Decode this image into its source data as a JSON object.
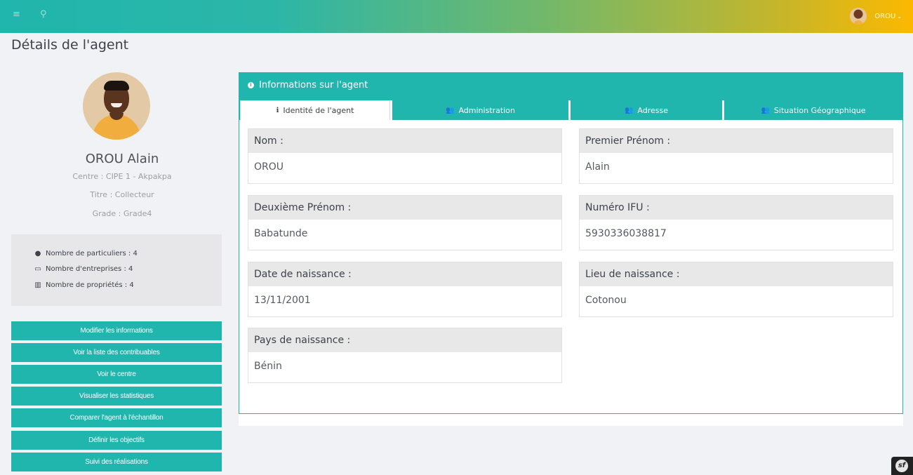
{
  "topbar": {
    "menu_icon": "hamburger-icon",
    "search_icon": "search-icon",
    "user_name": "OROU",
    "caret": "⌄"
  },
  "page": {
    "title": "Détails de l'agent"
  },
  "profile": {
    "name": "OROU Alain",
    "centre": "Centre : CIPE 1 - Akpakpa",
    "titre": "Titre : Collecteur",
    "grade": "Grade : Grade4"
  },
  "stats": [
    {
      "icon": "user-icon",
      "label": "Nombre de particuliers : 4"
    },
    {
      "icon": "desktop-icon",
      "label": "Nombre d'entreprises : 4"
    },
    {
      "icon": "bank-icon",
      "label": "Nombre de propriétés : 4"
    }
  ],
  "actions": [
    "Modifier les informations",
    "Voir la liste des contribuables",
    "Voir le centre",
    "Visualiser les statistiques",
    "Comparer l'agent à l'échantillon",
    "Définir les objectifs",
    "Suivi des réalisations"
  ],
  "panel": {
    "title": "Informations sur l'agent",
    "tabs": [
      {
        "icon": "info-icon",
        "label": "Identité de l'agent",
        "active": true
      },
      {
        "icon": "users-icon",
        "label": "Administration"
      },
      {
        "icon": "users-icon",
        "label": "Adresse"
      },
      {
        "icon": "users-icon",
        "label": "Situation Géographique"
      }
    ]
  },
  "fields": [
    {
      "label": "Nom :",
      "value": "OROU"
    },
    {
      "label": "Premier Prénom :",
      "value": "Alain"
    },
    {
      "label": "Deuxième Prénom :",
      "value": "Babatunde"
    },
    {
      "label": "Numéro IFU :",
      "value": "5930336038817"
    },
    {
      "label": "Date de naissance :",
      "value": "13/11/2001"
    },
    {
      "label": "Lieu de naissance :",
      "value": "Cotonou"
    },
    {
      "label": "Pays de naissance :",
      "value": "Bénin"
    }
  ],
  "colors": {
    "accent": "#20b5ad",
    "gradient_end": "#fcb800"
  }
}
